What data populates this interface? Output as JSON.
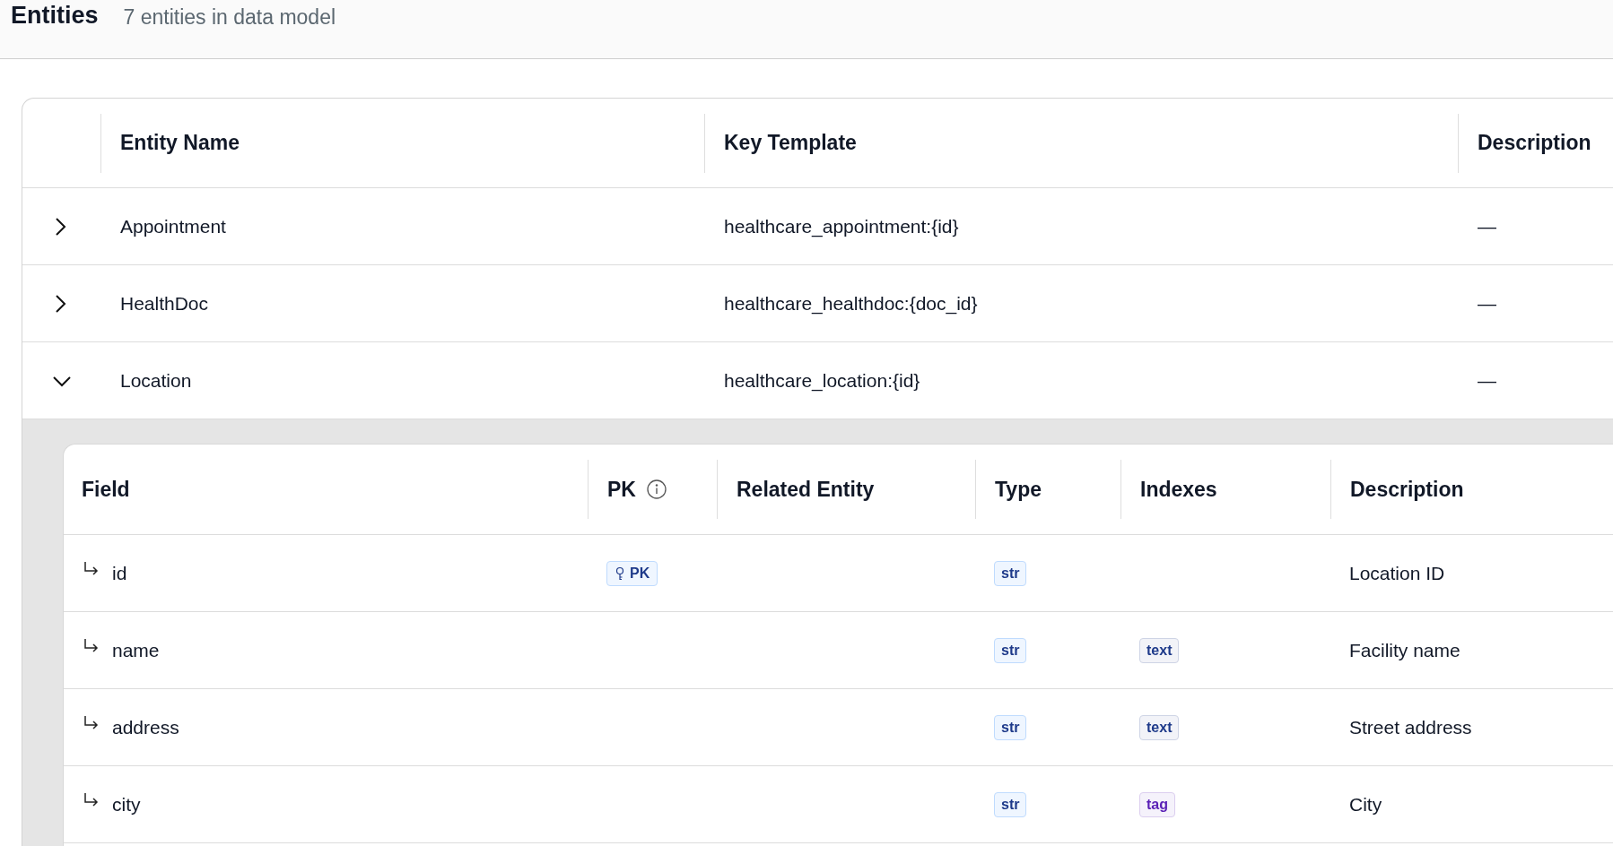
{
  "header": {
    "title": "Entities",
    "subtitle": "7 entities in data model"
  },
  "entities": {
    "columns": [
      "Entity Name",
      "Key Template",
      "Description"
    ],
    "rows": [
      {
        "name": "Appointment",
        "key_template": "healthcare_appointment:{id}",
        "description": "—",
        "expanded": false
      },
      {
        "name": "HealthDoc",
        "key_template": "healthcare_healthdoc:{doc_id}",
        "description": "—",
        "expanded": false
      },
      {
        "name": "Location",
        "key_template": "healthcare_location:{id}",
        "description": "—",
        "expanded": true,
        "fields": {
          "columns": [
            {
              "label": "Field",
              "info": false
            },
            {
              "label": "PK",
              "info": true
            },
            {
              "label": "Related Entity",
              "info": false
            },
            {
              "label": "Type",
              "info": false
            },
            {
              "label": "Indexes",
              "info": false
            },
            {
              "label": "Description",
              "info": false
            }
          ],
          "rows": [
            {
              "field": "id",
              "pk": "PK",
              "type": "str",
              "indexes": [],
              "description": "Location ID"
            },
            {
              "field": "name",
              "type": "str",
              "indexes": [
                {
                  "label": "text",
                  "color": "#1e3a8a"
                }
              ],
              "description": "Facility name"
            },
            {
              "field": "address",
              "type": "str",
              "indexes": [
                {
                  "label": "text",
                  "color": "#1e3a8a"
                }
              ],
              "description": "Street address"
            },
            {
              "field": "city",
              "type": "str",
              "indexes": [
                {
                  "label": "tag",
                  "color": "#5b21b6"
                }
              ],
              "description": "City"
            }
          ]
        }
      }
    ]
  }
}
